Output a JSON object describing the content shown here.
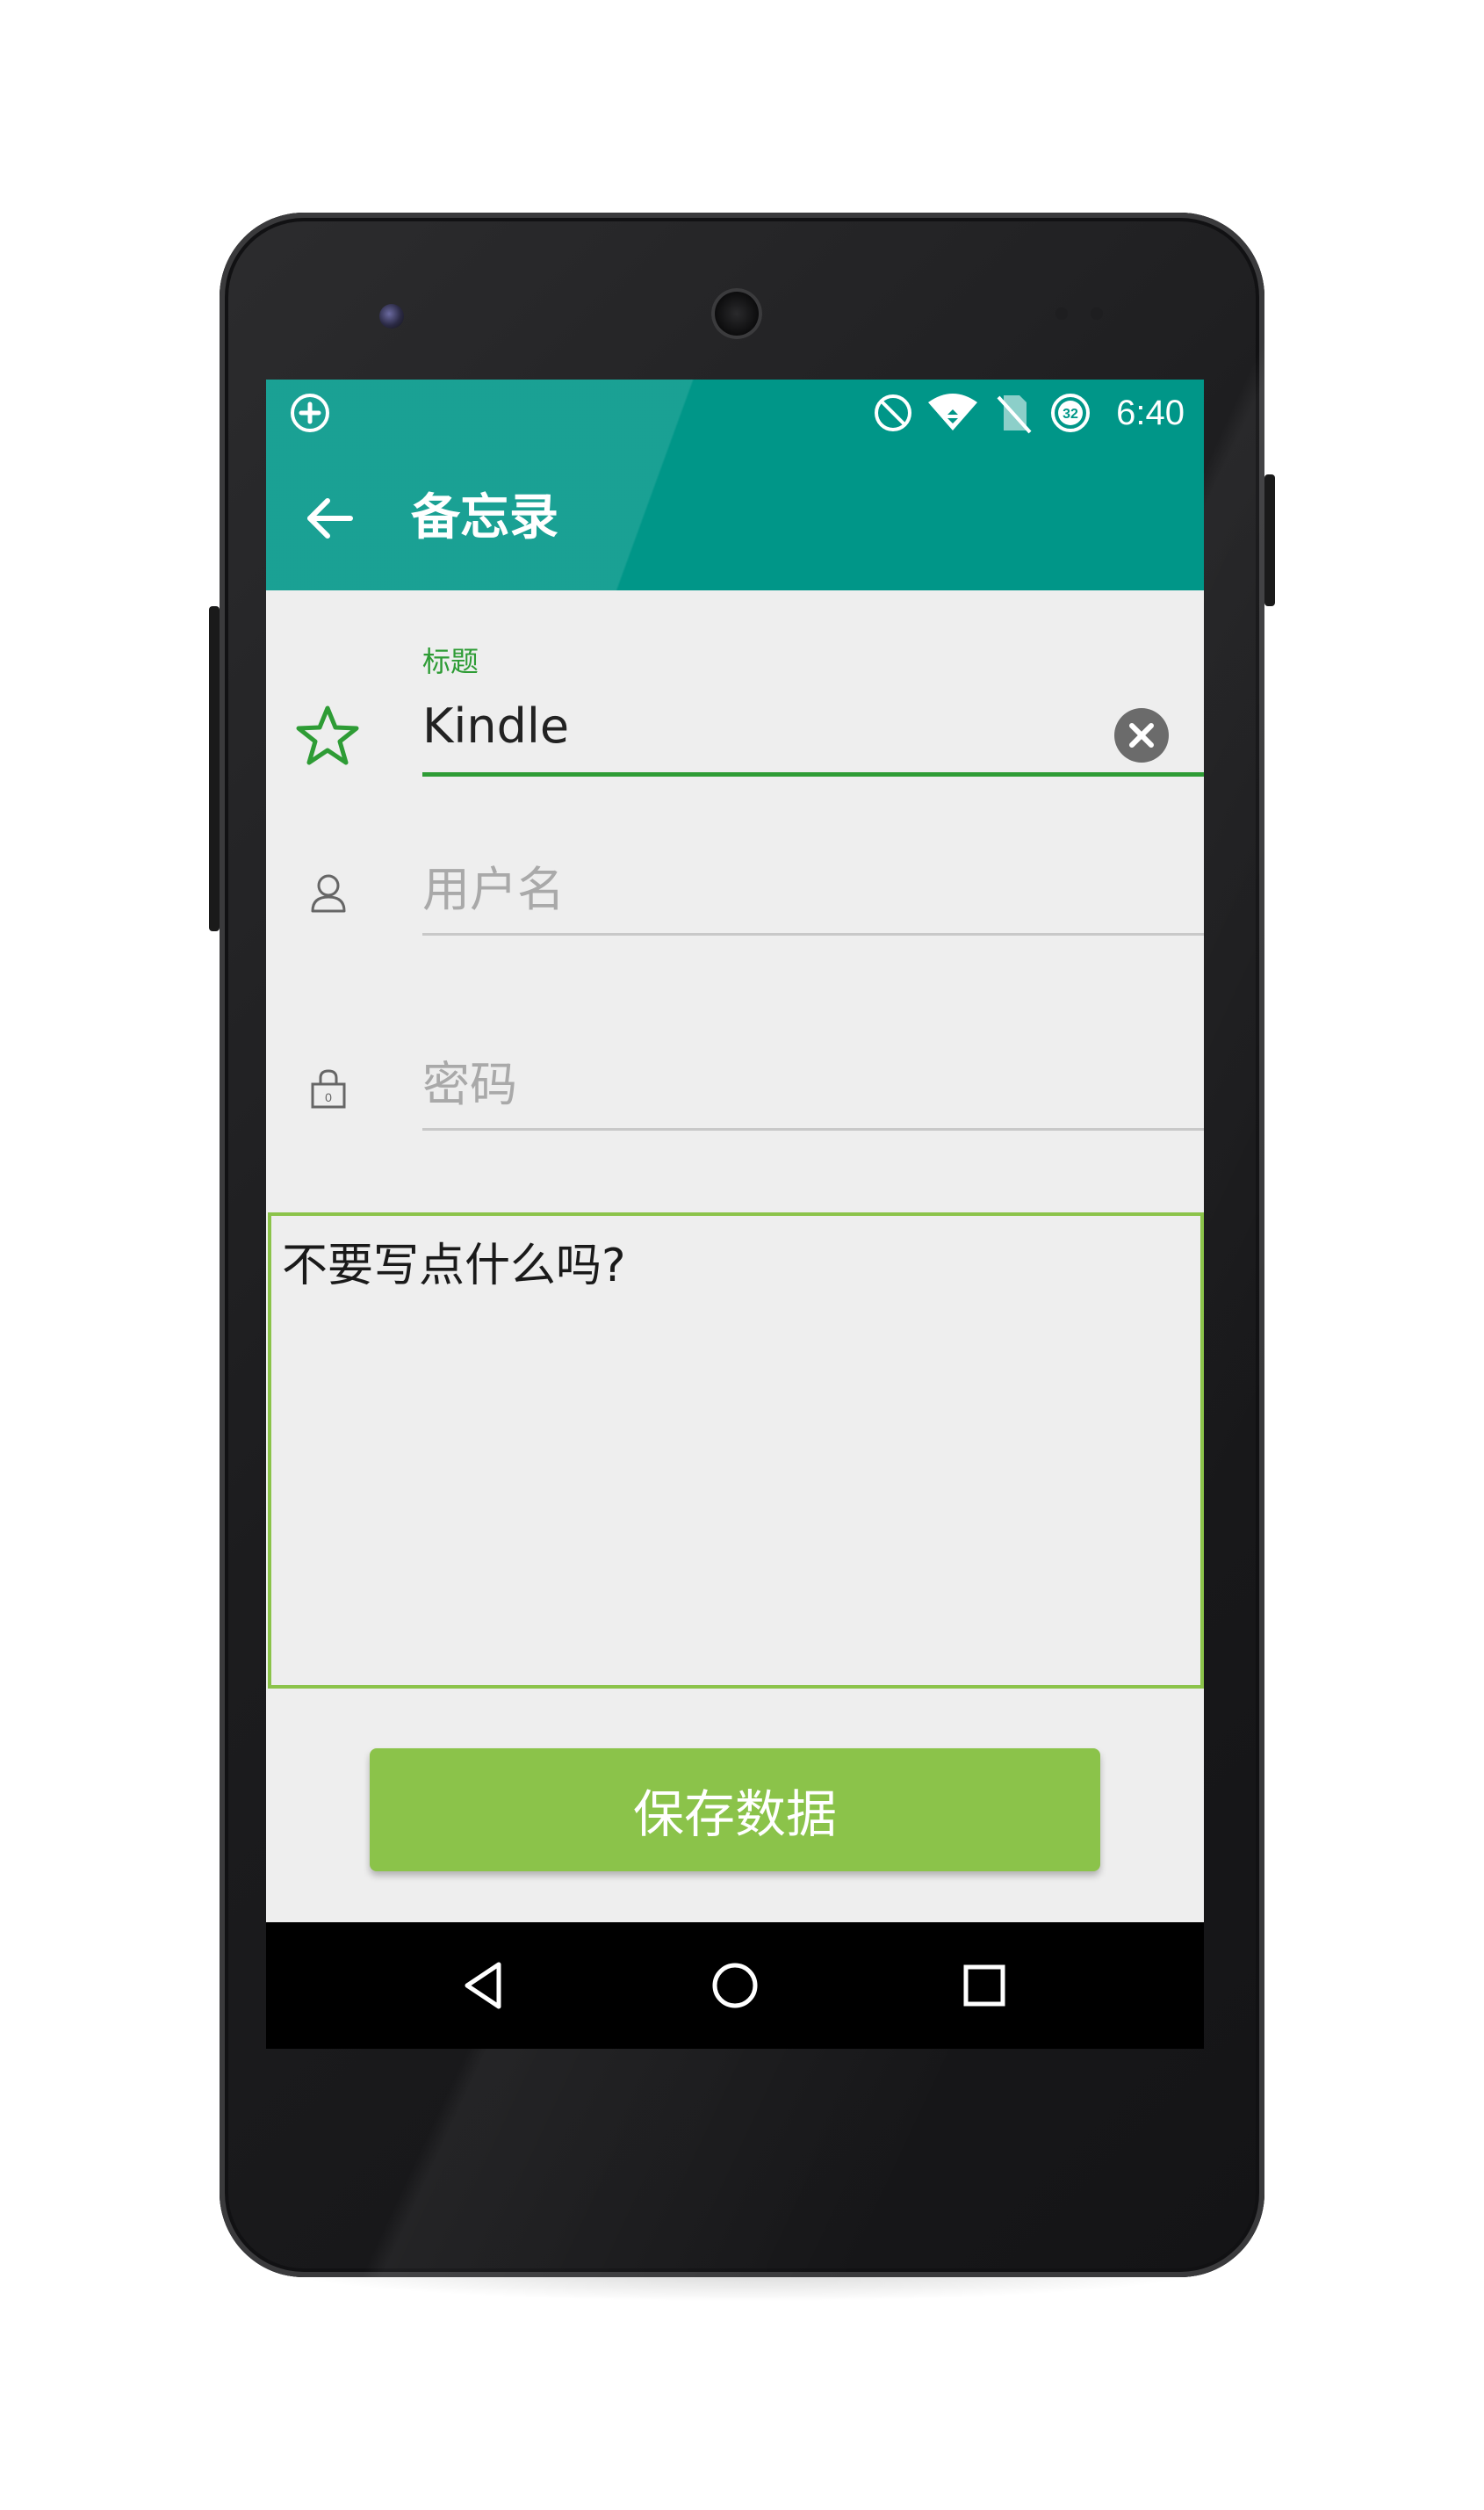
{
  "status_bar": {
    "time": "6:40",
    "battery_level": "32",
    "icons": [
      "add-circle-icon",
      "do-not-disturb-icon",
      "wifi-icon",
      "no-sim-icon",
      "battery-icon"
    ]
  },
  "toolbar": {
    "title": "备忘录",
    "back_icon": "arrow-back-icon"
  },
  "form": {
    "title_field": {
      "label": "标题",
      "value": "Kindle",
      "icon": "star-outline-icon",
      "clear_icon": "clear-icon"
    },
    "username_field": {
      "placeholder": "用户名",
      "value": "",
      "icon": "person-icon"
    },
    "password_field": {
      "placeholder": "密码",
      "value": "",
      "icon": "lock-icon",
      "lock_digit": "0"
    },
    "notes": {
      "placeholder": "不要写点什么吗?",
      "value": ""
    },
    "save_label": "保存数据"
  },
  "nav_bar": {
    "icons": [
      "back-triangle-icon",
      "home-circle-icon",
      "recents-square-icon"
    ]
  },
  "colors": {
    "app_bar": "#009688",
    "accent_green": "#2e9c35",
    "button_green": "#8bc34a",
    "background": "#eeeeee"
  }
}
